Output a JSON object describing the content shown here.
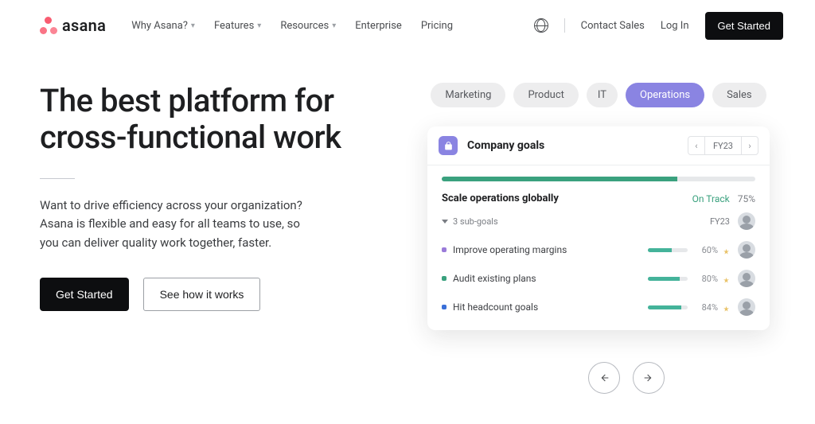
{
  "nav": {
    "brand": "asana",
    "items": [
      "Why Asana?",
      "Features",
      "Resources",
      "Enterprise",
      "Pricing"
    ],
    "contact": "Contact Sales",
    "login": "Log In",
    "cta": "Get Started"
  },
  "hero": {
    "title": "The best platform for cross-functional work",
    "desc": "Want to drive efficiency across your organization? Asana is flexible and easy for all teams to use, so you can deliver quality work together, faster.",
    "primary": "Get Started",
    "secondary": "See how it works"
  },
  "tabs": [
    "Marketing",
    "Product",
    "IT",
    "Operations",
    "Sales"
  ],
  "active_tab": 3,
  "card": {
    "title": "Company goals",
    "period": "FY23",
    "bar_pct": 75,
    "main_goal": {
      "name": "Scale operations globally",
      "status": "On Track",
      "pct": "75%"
    },
    "sub_label": "3 sub-goals",
    "sub_period": "FY23",
    "sub_goals": [
      {
        "name": "Improve operating margins",
        "pct": 60,
        "pct_label": "60%",
        "color": "#9a7bd9"
      },
      {
        "name": "Audit existing plans",
        "pct": 80,
        "pct_label": "80%",
        "color": "#3aa17e"
      },
      {
        "name": "Hit headcount goals",
        "pct": 84,
        "pct_label": "84%",
        "color": "#3a6fd8"
      }
    ]
  }
}
